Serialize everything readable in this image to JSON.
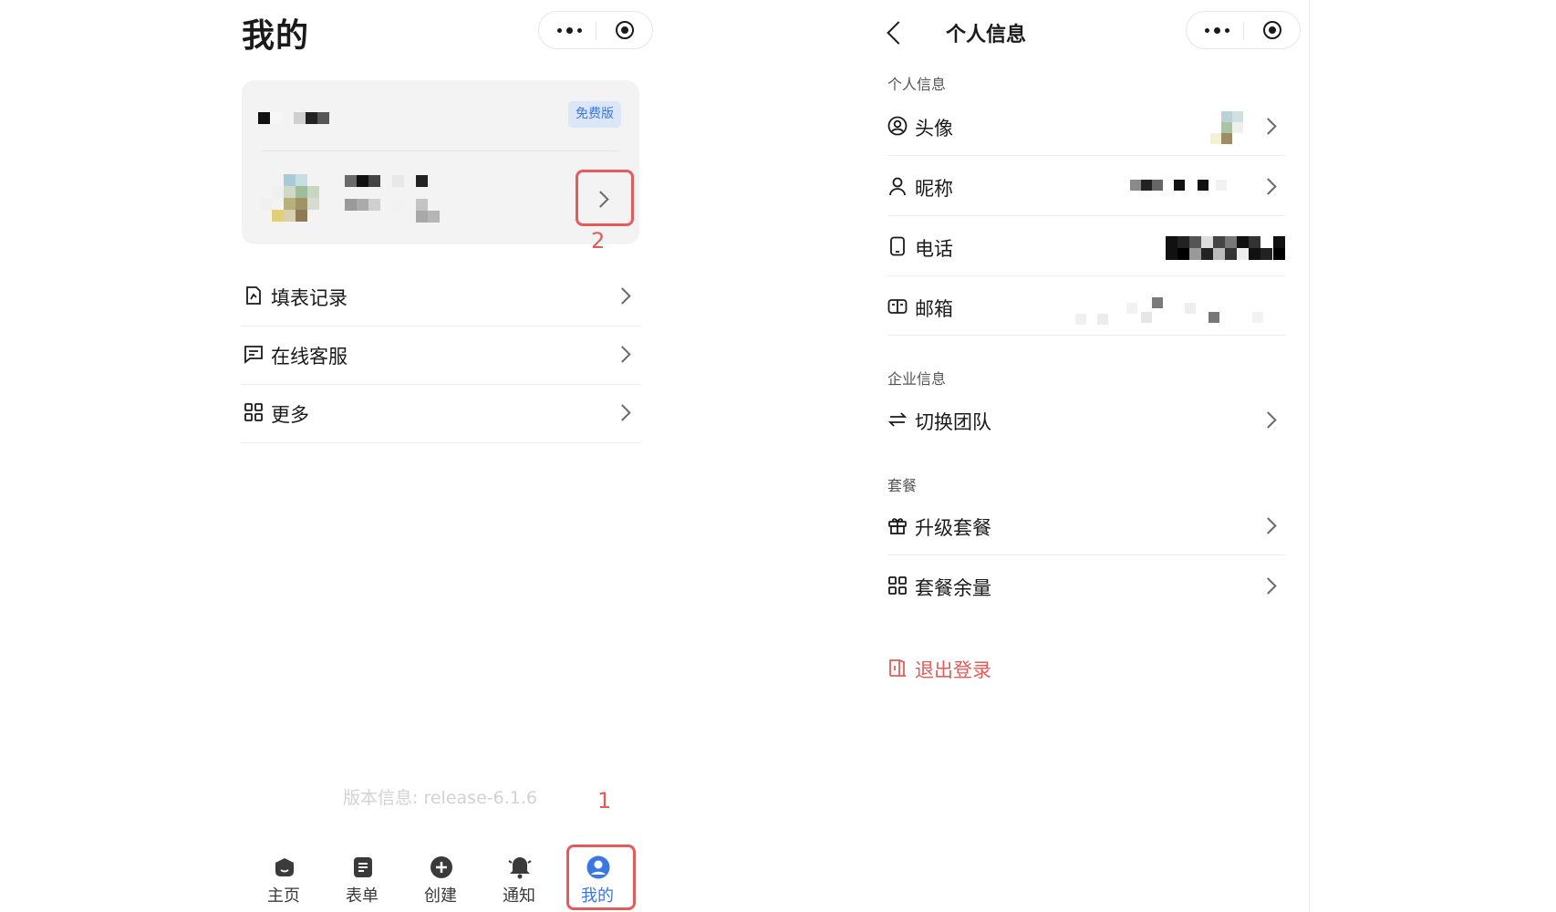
{
  "left": {
    "title": "我的",
    "card": {
      "plan_badge": "免费版"
    },
    "menu": [
      {
        "label": "填表记录",
        "icon": "form-record-icon"
      },
      {
        "label": "在线客服",
        "icon": "chat-icon"
      },
      {
        "label": "更多",
        "icon": "grid-icon"
      }
    ],
    "version": "版本信息: release-6.1.6",
    "annotations": {
      "step1": "1",
      "step2": "2"
    },
    "tabbar": [
      {
        "label": "主页",
        "icon": "home-icon"
      },
      {
        "label": "表单",
        "icon": "form-icon"
      },
      {
        "label": "创建",
        "icon": "plus-circle-icon"
      },
      {
        "label": "通知",
        "icon": "bell-icon"
      },
      {
        "label": "我的",
        "icon": "user-icon",
        "active": true
      }
    ]
  },
  "right": {
    "title": "个人信息",
    "sections": {
      "personal": "个人信息",
      "enterprise": "企业信息",
      "plan": "套餐"
    },
    "personal_rows": [
      {
        "label": "头像",
        "icon": "avatar-circle-icon"
      },
      {
        "label": "昵称",
        "icon": "person-icon"
      },
      {
        "label": "电话",
        "icon": "phone-icon"
      },
      {
        "label": "邮箱",
        "icon": "mail-icon"
      }
    ],
    "enterprise_rows": [
      {
        "label": "切换团队",
        "icon": "swap-icon"
      }
    ],
    "plan_rows": [
      {
        "label": "升级套餐",
        "icon": "gift-icon"
      },
      {
        "label": "套餐余量",
        "icon": "grid-icon"
      }
    ],
    "logout": {
      "label": "退出登录",
      "icon": "door-exit-icon"
    }
  },
  "colors": {
    "accent": "#3a78e0",
    "annotation": "#e45b5b",
    "logout": "#e45b5b"
  }
}
